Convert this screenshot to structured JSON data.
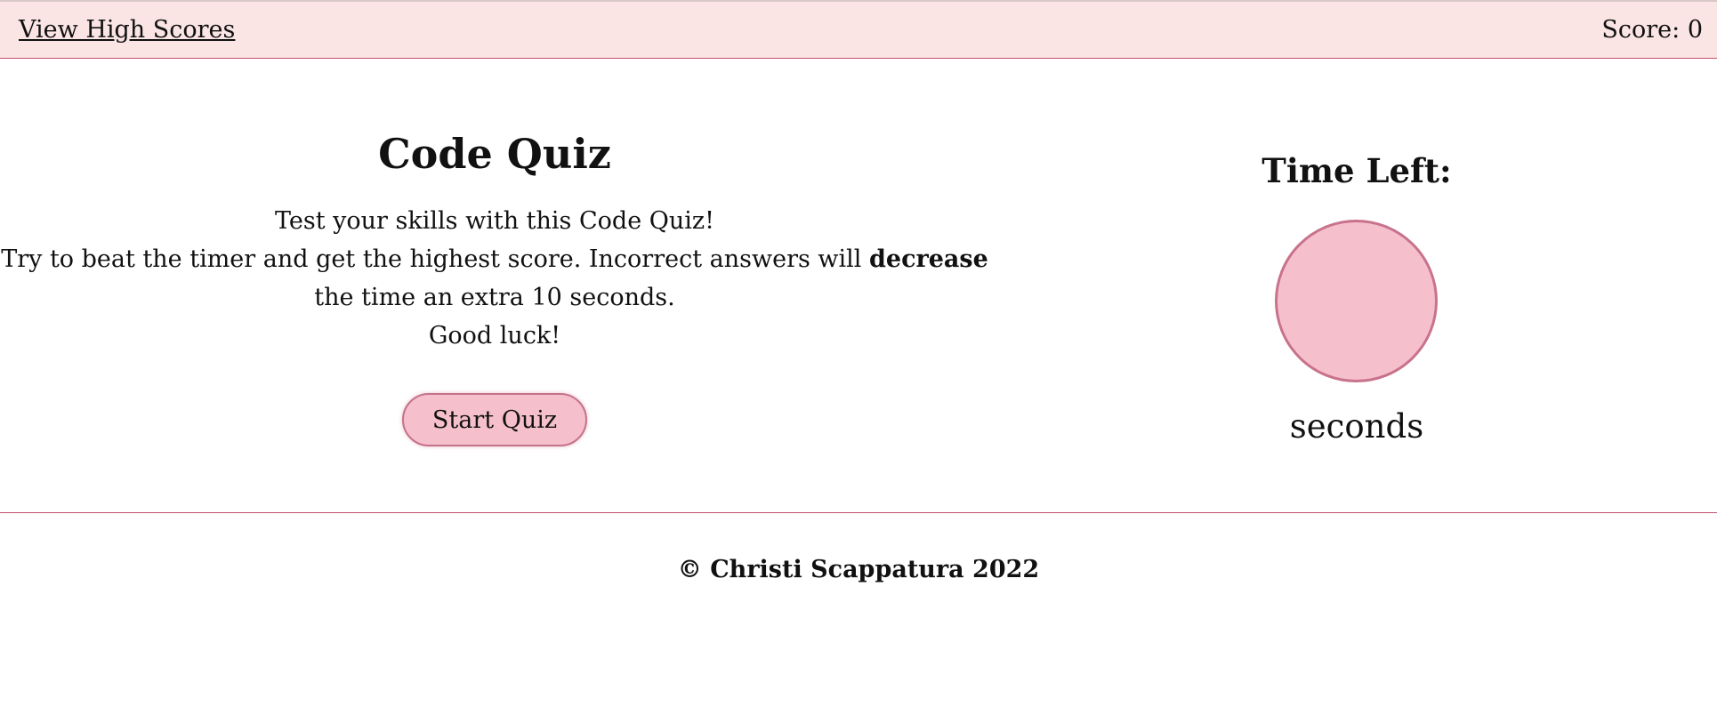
{
  "header": {
    "high_scores_link": "View High Scores",
    "score_label": "Score: 0"
  },
  "intro": {
    "title": "Code Quiz",
    "line1": "Test your skills with this Code Quiz!",
    "line2_before": "Try to beat the timer and get the highest score. Incorrect answers will ",
    "line2_bold": "decrease",
    "line3": "the time an extra 10 seconds.",
    "line4": "Good luck!",
    "start_button": "Start Quiz"
  },
  "timer": {
    "label": "Time Left:",
    "value": "",
    "unit": "seconds"
  },
  "footer": {
    "copyright": "© Christi Scappatura 2022"
  },
  "colors": {
    "header_bg": "#fbe4e4",
    "accent_border": "#c2506f",
    "button_fill": "#f5c0cc"
  }
}
